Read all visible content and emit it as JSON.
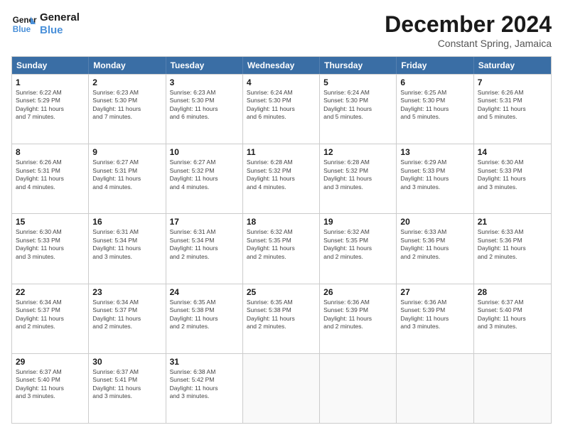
{
  "logo": {
    "line1": "General",
    "line2": "Blue"
  },
  "title": "December 2024",
  "subtitle": "Constant Spring, Jamaica",
  "header_days": [
    "Sunday",
    "Monday",
    "Tuesday",
    "Wednesday",
    "Thursday",
    "Friday",
    "Saturday"
  ],
  "weeks": [
    [
      {
        "day": "1",
        "info": "Sunrise: 6:22 AM\nSunset: 5:29 PM\nDaylight: 11 hours\nand 7 minutes."
      },
      {
        "day": "2",
        "info": "Sunrise: 6:23 AM\nSunset: 5:30 PM\nDaylight: 11 hours\nand 7 minutes."
      },
      {
        "day": "3",
        "info": "Sunrise: 6:23 AM\nSunset: 5:30 PM\nDaylight: 11 hours\nand 6 minutes."
      },
      {
        "day": "4",
        "info": "Sunrise: 6:24 AM\nSunset: 5:30 PM\nDaylight: 11 hours\nand 6 minutes."
      },
      {
        "day": "5",
        "info": "Sunrise: 6:24 AM\nSunset: 5:30 PM\nDaylight: 11 hours\nand 5 minutes."
      },
      {
        "day": "6",
        "info": "Sunrise: 6:25 AM\nSunset: 5:30 PM\nDaylight: 11 hours\nand 5 minutes."
      },
      {
        "day": "7",
        "info": "Sunrise: 6:26 AM\nSunset: 5:31 PM\nDaylight: 11 hours\nand 5 minutes."
      }
    ],
    [
      {
        "day": "8",
        "info": "Sunrise: 6:26 AM\nSunset: 5:31 PM\nDaylight: 11 hours\nand 4 minutes."
      },
      {
        "day": "9",
        "info": "Sunrise: 6:27 AM\nSunset: 5:31 PM\nDaylight: 11 hours\nand 4 minutes."
      },
      {
        "day": "10",
        "info": "Sunrise: 6:27 AM\nSunset: 5:32 PM\nDaylight: 11 hours\nand 4 minutes."
      },
      {
        "day": "11",
        "info": "Sunrise: 6:28 AM\nSunset: 5:32 PM\nDaylight: 11 hours\nand 4 minutes."
      },
      {
        "day": "12",
        "info": "Sunrise: 6:28 AM\nSunset: 5:32 PM\nDaylight: 11 hours\nand 3 minutes."
      },
      {
        "day": "13",
        "info": "Sunrise: 6:29 AM\nSunset: 5:33 PM\nDaylight: 11 hours\nand 3 minutes."
      },
      {
        "day": "14",
        "info": "Sunrise: 6:30 AM\nSunset: 5:33 PM\nDaylight: 11 hours\nand 3 minutes."
      }
    ],
    [
      {
        "day": "15",
        "info": "Sunrise: 6:30 AM\nSunset: 5:33 PM\nDaylight: 11 hours\nand 3 minutes."
      },
      {
        "day": "16",
        "info": "Sunrise: 6:31 AM\nSunset: 5:34 PM\nDaylight: 11 hours\nand 3 minutes."
      },
      {
        "day": "17",
        "info": "Sunrise: 6:31 AM\nSunset: 5:34 PM\nDaylight: 11 hours\nand 2 minutes."
      },
      {
        "day": "18",
        "info": "Sunrise: 6:32 AM\nSunset: 5:35 PM\nDaylight: 11 hours\nand 2 minutes."
      },
      {
        "day": "19",
        "info": "Sunrise: 6:32 AM\nSunset: 5:35 PM\nDaylight: 11 hours\nand 2 minutes."
      },
      {
        "day": "20",
        "info": "Sunrise: 6:33 AM\nSunset: 5:36 PM\nDaylight: 11 hours\nand 2 minutes."
      },
      {
        "day": "21",
        "info": "Sunrise: 6:33 AM\nSunset: 5:36 PM\nDaylight: 11 hours\nand 2 minutes."
      }
    ],
    [
      {
        "day": "22",
        "info": "Sunrise: 6:34 AM\nSunset: 5:37 PM\nDaylight: 11 hours\nand 2 minutes."
      },
      {
        "day": "23",
        "info": "Sunrise: 6:34 AM\nSunset: 5:37 PM\nDaylight: 11 hours\nand 2 minutes."
      },
      {
        "day": "24",
        "info": "Sunrise: 6:35 AM\nSunset: 5:38 PM\nDaylight: 11 hours\nand 2 minutes."
      },
      {
        "day": "25",
        "info": "Sunrise: 6:35 AM\nSunset: 5:38 PM\nDaylight: 11 hours\nand 2 minutes."
      },
      {
        "day": "26",
        "info": "Sunrise: 6:36 AM\nSunset: 5:39 PM\nDaylight: 11 hours\nand 2 minutes."
      },
      {
        "day": "27",
        "info": "Sunrise: 6:36 AM\nSunset: 5:39 PM\nDaylight: 11 hours\nand 3 minutes."
      },
      {
        "day": "28",
        "info": "Sunrise: 6:37 AM\nSunset: 5:40 PM\nDaylight: 11 hours\nand 3 minutes."
      }
    ],
    [
      {
        "day": "29",
        "info": "Sunrise: 6:37 AM\nSunset: 5:40 PM\nDaylight: 11 hours\nand 3 minutes."
      },
      {
        "day": "30",
        "info": "Sunrise: 6:37 AM\nSunset: 5:41 PM\nDaylight: 11 hours\nand 3 minutes."
      },
      {
        "day": "31",
        "info": "Sunrise: 6:38 AM\nSunset: 5:42 PM\nDaylight: 11 hours\nand 3 minutes."
      },
      {
        "day": "",
        "info": ""
      },
      {
        "day": "",
        "info": ""
      },
      {
        "day": "",
        "info": ""
      },
      {
        "day": "",
        "info": ""
      }
    ]
  ]
}
